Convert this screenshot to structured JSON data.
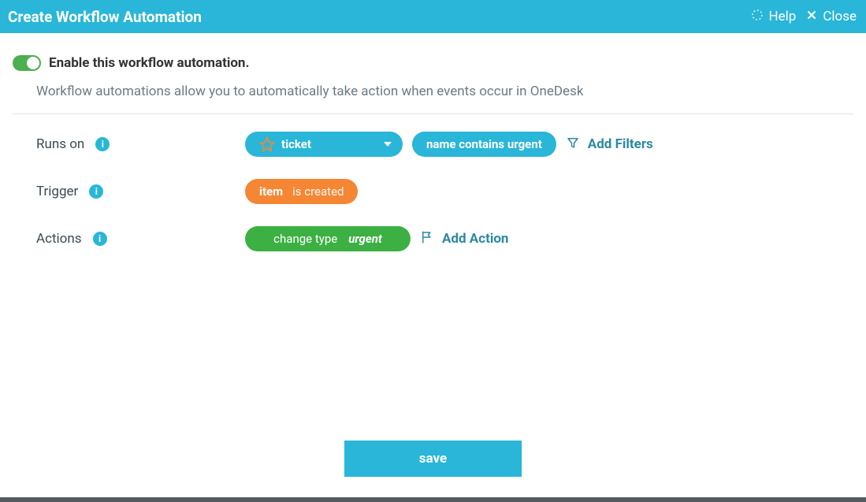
{
  "header": {
    "title": "Create Workflow Automation",
    "help_label": "Help",
    "close_label": "Close"
  },
  "enable": {
    "label": "Enable this workflow automation.",
    "enabled": true
  },
  "description": "Workflow automations allow you to automatically take action when events occur in OneDesk",
  "runs_on": {
    "label": "Runs on",
    "type_value": "ticket",
    "filter_text": "name contains urgent",
    "add_filters_label": "Add Filters"
  },
  "trigger": {
    "label": "Trigger",
    "subject": "item",
    "predicate": "is created"
  },
  "actions": {
    "label": "Actions",
    "action_name": "change type",
    "action_value": "urgent",
    "add_action_label": "Add Action"
  },
  "save_label": "save"
}
